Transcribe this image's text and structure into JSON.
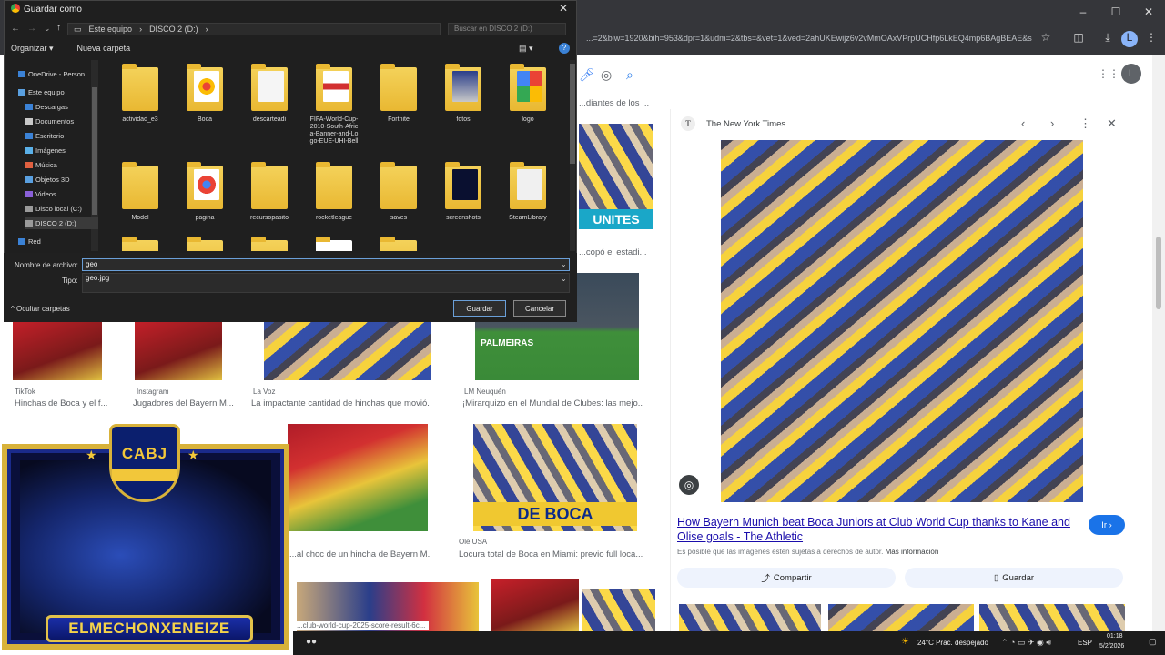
{
  "browser": {
    "url": "...=2&biw=1920&bih=953&dpr=1&udm=2&tbs=&vet=1&ved=2ahUKEwijz6v2vMmOAxVPrpUCHfp6LkEQ4mp6BAgBEAE&source=mw...",
    "profile_initial": "L"
  },
  "dialog": {
    "title": "Guardar como",
    "address_segments": [
      "Este equipo",
      "DISCO 2 (D:)"
    ],
    "search_placeholder": "Buscar en DISCO 2 (D:)",
    "organize_label": "Organizar ▾",
    "new_folder_label": "Nueva carpeta",
    "nav_items": [
      {
        "label": "OneDrive - Person",
        "icon": "cloud-icon"
      },
      {
        "label": "Este equipo",
        "icon": "computer-icon"
      },
      {
        "label": "Descargas",
        "icon": "download-icon"
      },
      {
        "label": "Documentos",
        "icon": "document-icon"
      },
      {
        "label": "Escritorio",
        "icon": "desktop-icon"
      },
      {
        "label": "Imágenes",
        "icon": "image-icon"
      },
      {
        "label": "Música",
        "icon": "music-icon"
      },
      {
        "label": "Objetos 3D",
        "icon": "cube-icon"
      },
      {
        "label": "Videos",
        "icon": "video-icon"
      },
      {
        "label": "Disco local (C:)",
        "icon": "drive-icon"
      },
      {
        "label": "DISCO 2 (D:)",
        "icon": "drive-icon"
      },
      {
        "label": "Red",
        "icon": "network-icon"
      }
    ],
    "files": [
      {
        "name": "actividad_e3"
      },
      {
        "name": "Boca"
      },
      {
        "name": "descarteadi"
      },
      {
        "name": "FIFA-World-Cup-2010-South-Africa-Banner-and-Logo-EUE-UHI-Bell"
      },
      {
        "name": "Fortnite"
      },
      {
        "name": "fotos"
      },
      {
        "name": "logo"
      },
      {
        "name": "Model"
      },
      {
        "name": "pagina"
      },
      {
        "name": "recursopasito"
      },
      {
        "name": "rocketleague"
      },
      {
        "name": "saves"
      },
      {
        "name": "screenshots"
      },
      {
        "name": "SteamLibrary"
      }
    ],
    "filename_label": "Nombre de archivo:",
    "filename_value": "geo",
    "filetype_label": "Tipo:",
    "filetype_value": "geo.jpg",
    "hide_folders_label": "Ocultar carpetas",
    "save_label": "Guardar",
    "cancel_label": "Cancelar"
  },
  "results": {
    "top_caption": "...diantes de los ...",
    "mid_caption": "...copó el estadi...",
    "row2_sources": [
      "TikTok",
      "Instagram",
      "La Voz",
      "LM Neuquén"
    ],
    "row2_titles": [
      "Hinchas de Boca y el f...",
      "Jugadores del Bayern M...",
      "La impactante cantidad de hinchas que movió...",
      "¡Mirarquizo en el Mundial de Clubes: las mejo..."
    ],
    "row3_sources": [
      "Olé USA"
    ],
    "row3_titles": [
      "...al choc de un hincha de Bayern M...",
      "Locura total de Boca en Miami: previo full loca..."
    ],
    "tile_texts": {
      "unites": "UNITES",
      "palmeiras": "PALMEIRAS",
      "deboca": "DE BOCA"
    },
    "bottom_url": "...club-world-cup-2025-score-result-6c..."
  },
  "panel": {
    "source": "The New York Times",
    "title": "How Bayern Munich beat Boca Juniors at Club World Cup thanks to Kane and Olise goals - The Athletic",
    "disclaimer": "Es posible que las imágenes estén sujetas a derechos de autor.",
    "more_info": "Más información",
    "visit_label": "Ir ›",
    "share_label": "Compartir",
    "save_label": "Guardar"
  },
  "overlay": {
    "badge_text": "CABJ",
    "streamer_name": "ELMECHONXENEIZE"
  },
  "taskbar": {
    "weather": "24°C Prac. despejado",
    "language": "ESP",
    "time": "01:18",
    "date": "5/2/2026"
  },
  "colors": {
    "dialog_bg": "#1f1f1f",
    "boca_blue": "#0b1f6e",
    "boca_gold": "#f2c73a",
    "link_blue": "#1a0dab"
  }
}
